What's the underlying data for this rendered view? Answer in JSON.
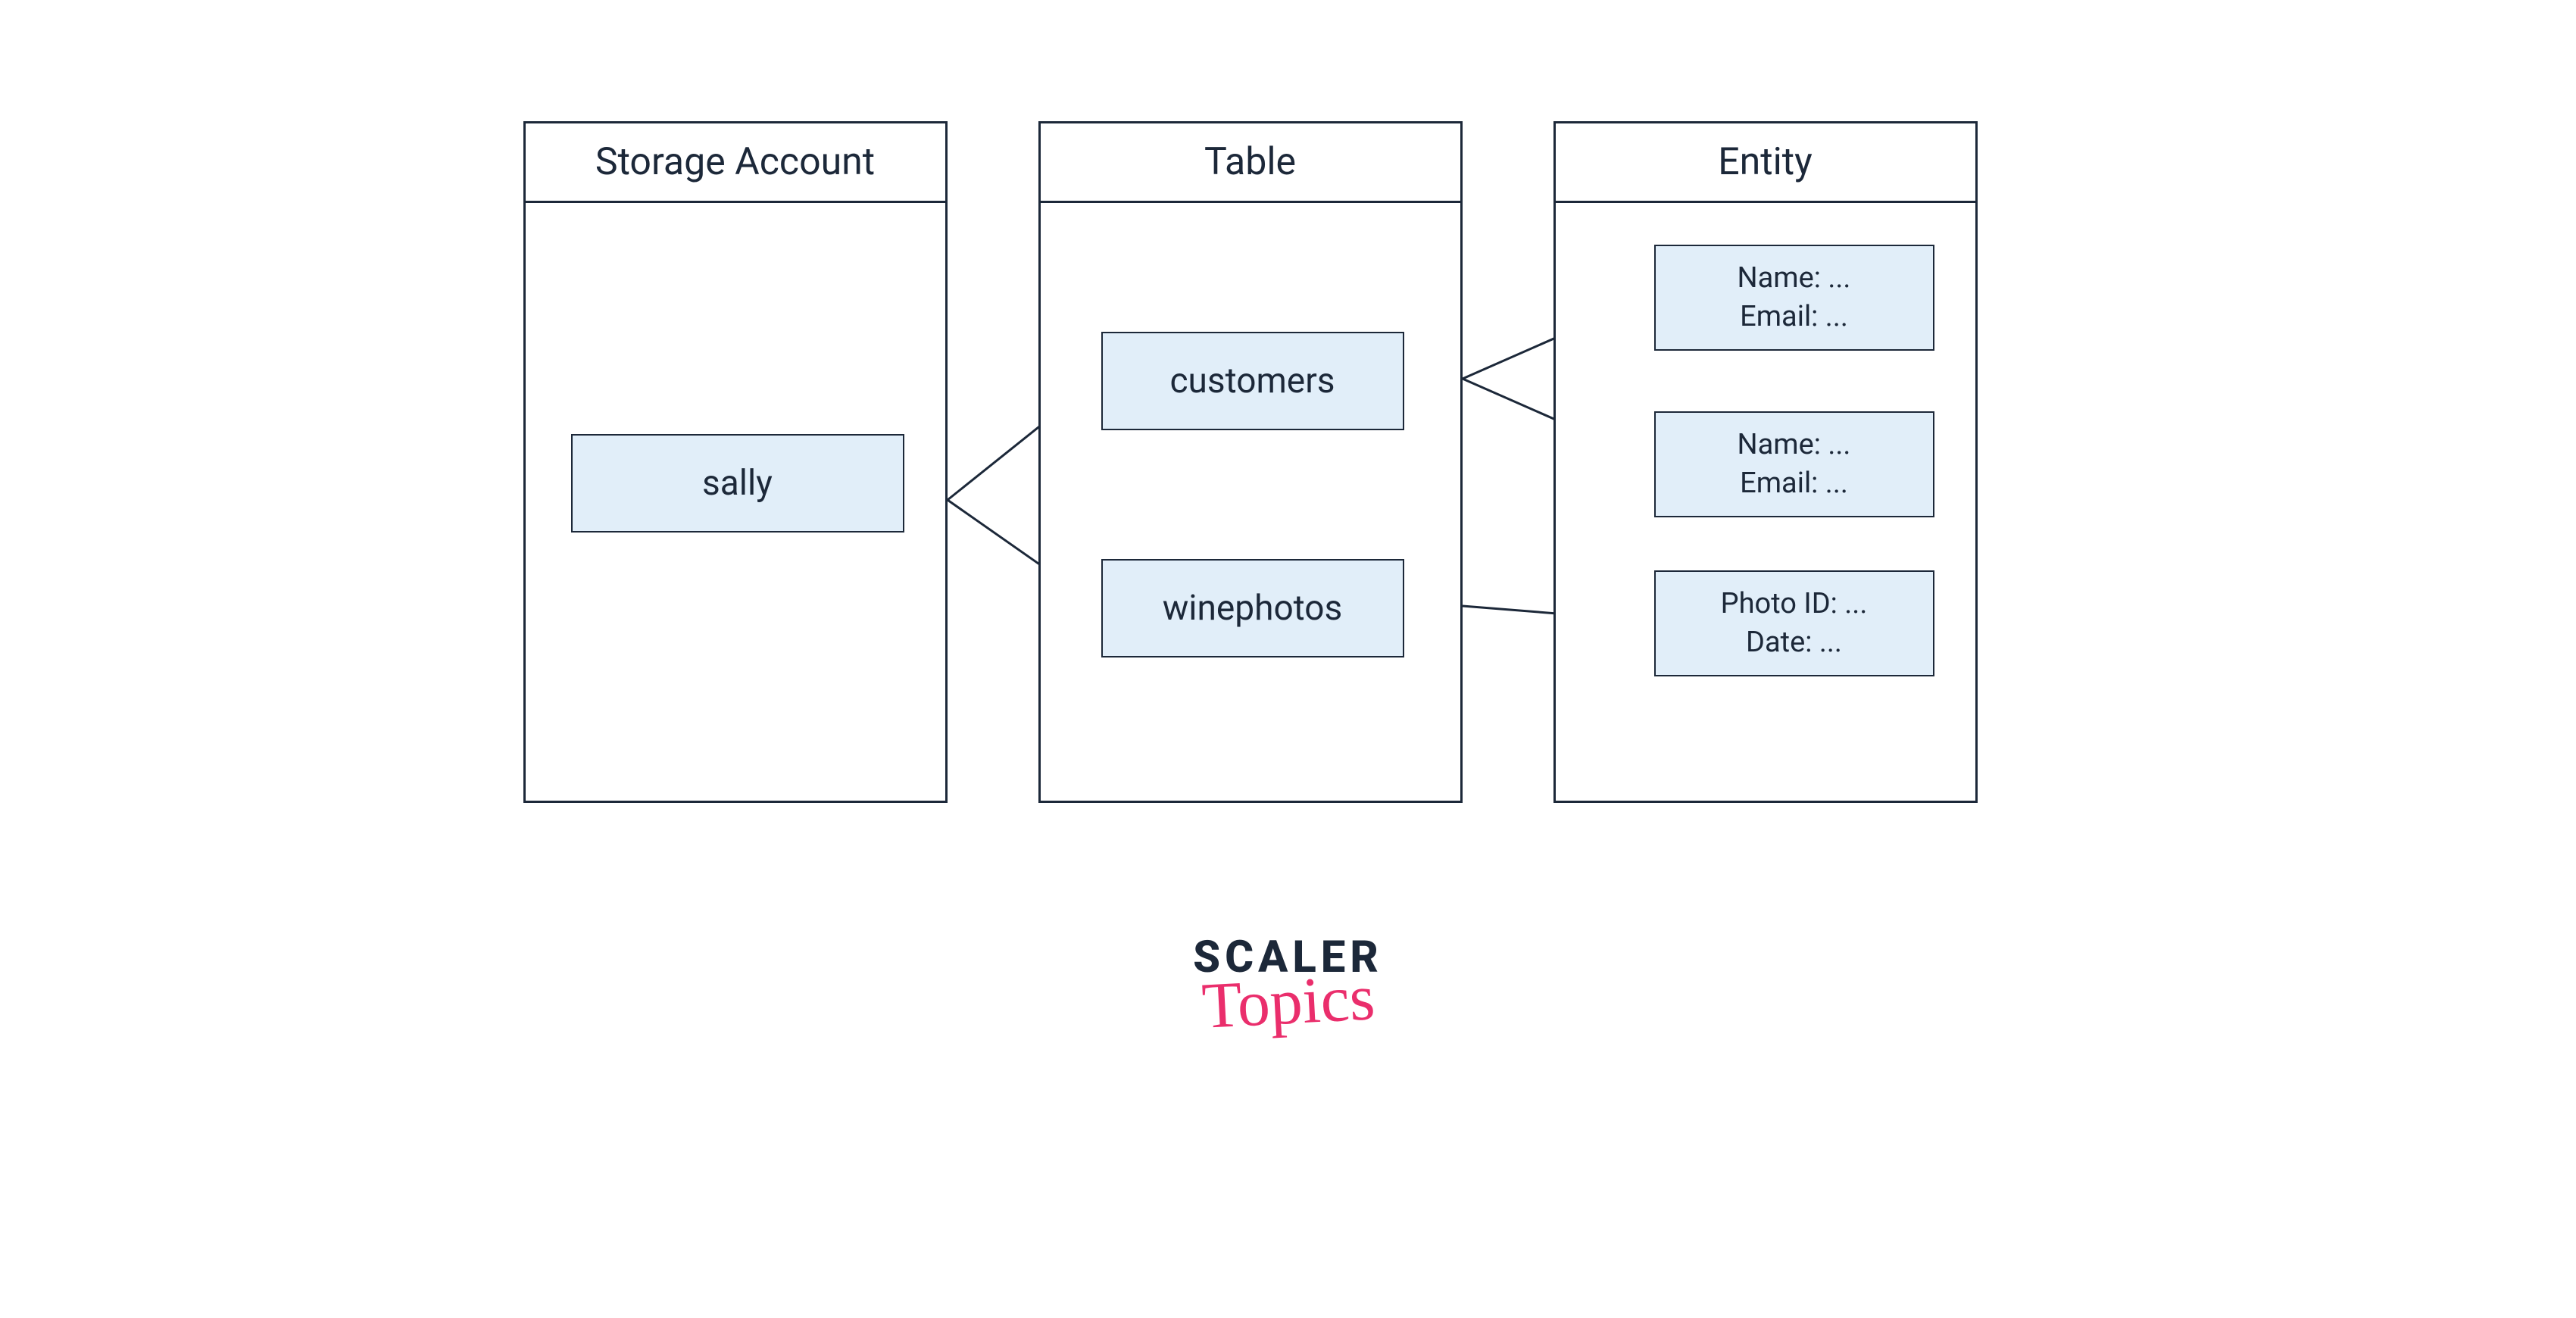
{
  "columns": {
    "storage": {
      "title": "Storage Account"
    },
    "table": {
      "title": "Table"
    },
    "entity": {
      "title": "Entity"
    }
  },
  "nodes": {
    "sally": "sally",
    "customers": "customers",
    "winephotos": "winephotos",
    "entity1_line1": "Name: ...",
    "entity1_line2": "Email: ...",
    "entity2_line1": "Name: ...",
    "entity2_line2": "Email: ...",
    "entity3_line1": "Photo ID: ...",
    "entity3_line2": "Date: ..."
  },
  "brand": {
    "line1": "SCALER",
    "line2": "Topics"
  },
  "colors": {
    "stroke": "#1c2839",
    "nodeFill": "#e1eef9",
    "accent": "#ea2e6c"
  }
}
